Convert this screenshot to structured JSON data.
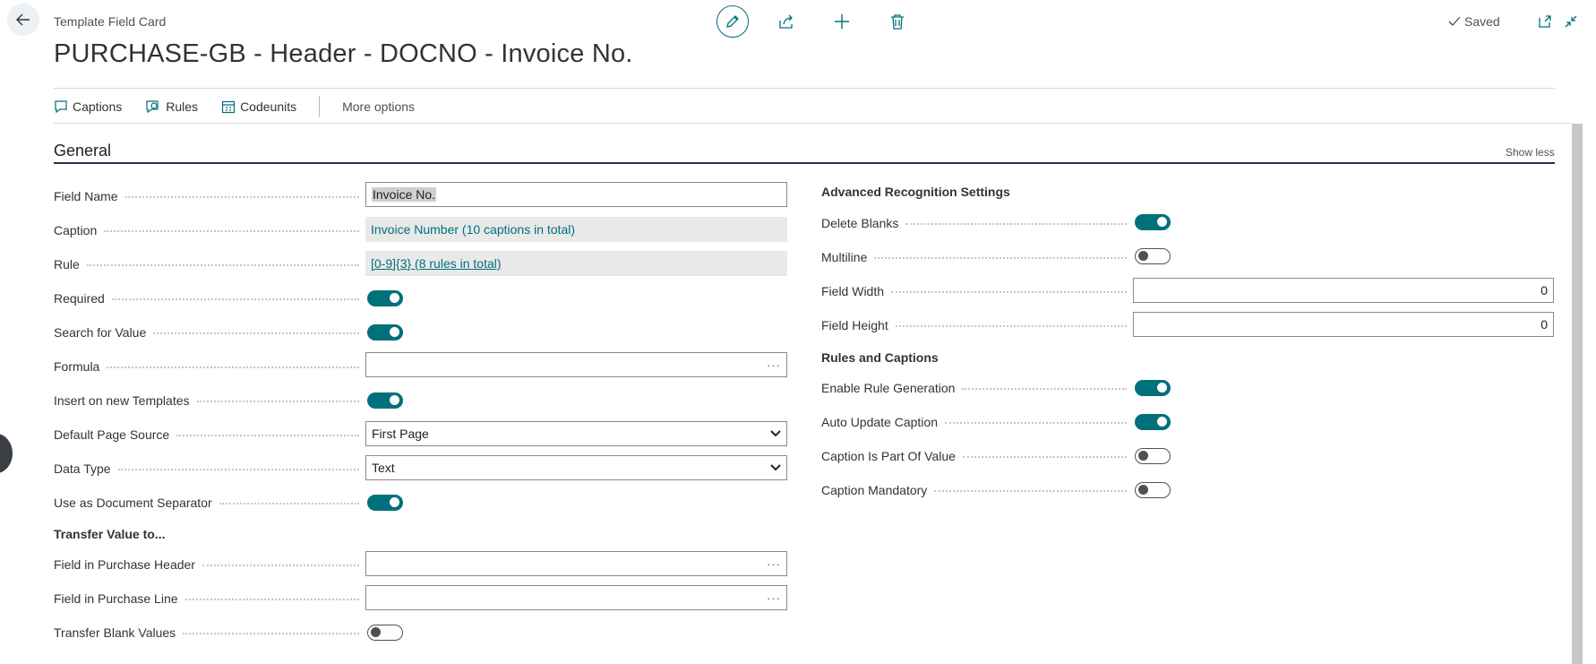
{
  "header": {
    "card_type": "Template Field Card",
    "title": "PURCHASE-GB - Header - DOCNO - Invoice No.",
    "saved_label": "Saved",
    "icons": {
      "back": "back-arrow-icon",
      "edit": "pencil-icon",
      "share": "share-icon",
      "new": "plus-icon",
      "delete": "trash-icon",
      "saved": "checkmark-icon",
      "open_new_window": "open-in-new-window-icon",
      "collapse": "collapse-icon"
    }
  },
  "actionbar": {
    "captions": "Captions",
    "rules": "Rules",
    "codeunits": "Codeunits",
    "more": "More options"
  },
  "section": {
    "title": "General",
    "show_less": "Show less"
  },
  "left": {
    "field_name": {
      "label": "Field Name",
      "value": "Invoice No."
    },
    "caption": {
      "label": "Caption",
      "value": "Invoice Number (10 captions in total)"
    },
    "rule": {
      "label": "Rule",
      "value": "[0-9]{3} (8 rules in total)"
    },
    "required": {
      "label": "Required",
      "on": true
    },
    "search_for_value": {
      "label": "Search for Value",
      "on": true
    },
    "formula": {
      "label": "Formula",
      "value": "",
      "ellipsis": "···"
    },
    "insert_on_new_templates": {
      "label": "Insert on new Templates",
      "on": true
    },
    "default_page_source": {
      "label": "Default Page Source",
      "value": "First Page"
    },
    "data_type": {
      "label": "Data Type",
      "value": "Text"
    },
    "use_as_document_separator": {
      "label": "Use as Document Separator",
      "on": true
    },
    "transfer_heading": "Transfer Value to...",
    "field_in_purchase_header": {
      "label": "Field in Purchase Header",
      "value": "",
      "ellipsis": "···"
    },
    "field_in_purchase_line": {
      "label": "Field in Purchase Line",
      "value": "",
      "ellipsis": "···"
    },
    "transfer_blank_values": {
      "label": "Transfer Blank Values",
      "on": false
    }
  },
  "right": {
    "advanced_heading": "Advanced Recognition Settings",
    "delete_blanks": {
      "label": "Delete Blanks",
      "on": true
    },
    "multiline": {
      "label": "Multiline",
      "on": false
    },
    "field_width": {
      "label": "Field Width",
      "value": "0"
    },
    "field_height": {
      "label": "Field Height",
      "value": "0"
    },
    "rules_heading": "Rules and Captions",
    "enable_rule_generation": {
      "label": "Enable Rule Generation",
      "on": true
    },
    "auto_update_caption": {
      "label": "Auto Update Caption",
      "on": true
    },
    "caption_is_part_of_value": {
      "label": "Caption Is Part Of Value",
      "on": false
    },
    "caption_mandatory": {
      "label": "Caption Mandatory",
      "on": false
    }
  },
  "colors": {
    "accent": "#00707a",
    "section_line": "#23344a",
    "readonly_bg": "#e9e9e9"
  }
}
